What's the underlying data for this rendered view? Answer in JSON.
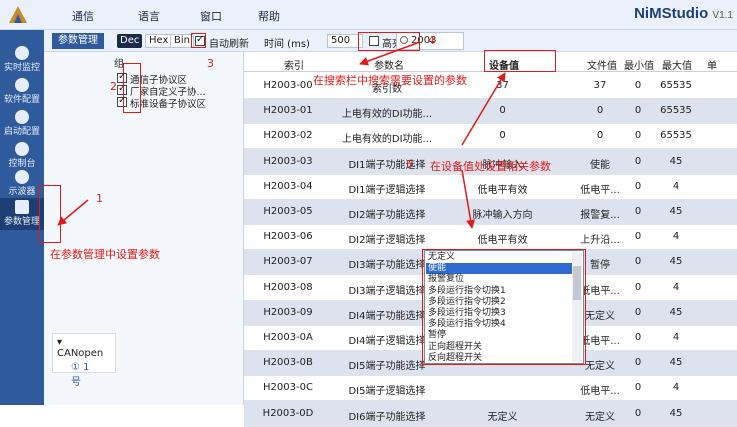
{
  "menubar": {
    "items": [
      "通信",
      "语言",
      "窗口",
      "帮助"
    ],
    "app_title": "NiMStudio",
    "app_version": "V1.1"
  },
  "left_rail": {
    "items": [
      "实时监控",
      "软件配置",
      "启动配置",
      "控制台",
      "示波器",
      "参数管理"
    ],
    "active": "参数管理"
  },
  "toolbar": {
    "param_tab": "参数管理",
    "dec": "Dec",
    "hex": "Hex",
    "bin": "Bin",
    "auto_refresh": "自动刷新",
    "time_label": "时间 (ms)",
    "time_value": "500",
    "highlight": "高亮",
    "search_value": "2003"
  },
  "group_panel": {
    "header": "组",
    "items": [
      "通信子协议区",
      "厂家自定义子协...",
      "标准设备子协议区"
    ],
    "tree_root": "CANopen",
    "tree_child": "1号"
  },
  "table": {
    "columns": [
      "索引",
      "参数名",
      "设备值",
      "文件值",
      "最小值",
      "最大值",
      "单"
    ],
    "rows": [
      [
        "H2003-00",
        "索引数",
        "37",
        "37",
        "0",
        "65535"
      ],
      [
        "H2003-01",
        "上电有效的DI功能...",
        "0",
        "0",
        "0",
        "65535"
      ],
      [
        "H2003-02",
        "上电有效的DI功能...",
        "0",
        "0",
        "0",
        "65535"
      ],
      [
        "H2003-03",
        "DI1端子功能选择",
        "脉冲输入",
        "使能",
        "0",
        "45"
      ],
      [
        "H2003-04",
        "DI1端子逻辑选择",
        "低电平有效",
        "低电平...",
        "0",
        "4"
      ],
      [
        "H2003-05",
        "DI2端子功能选择",
        "脉冲输入方向",
        "报警复...",
        "0",
        "45"
      ],
      [
        "H2003-06",
        "DI2端子逻辑选择",
        "低电平有效",
        "上升沿...",
        "0",
        "4"
      ],
      [
        "H2003-07",
        "DI3端子功能选择",
        "使能",
        "暂停",
        "0",
        "45"
      ],
      [
        "H2003-08",
        "DI3端子逻辑选择",
        "",
        "低电平...",
        "0",
        "4"
      ],
      [
        "H2003-09",
        "DI4端子功能选择",
        "",
        "无定义",
        "0",
        "45"
      ],
      [
        "H2003-0A",
        "DI4端子逻辑选择",
        "",
        "低电平...",
        "0",
        "4"
      ],
      [
        "H2003-0B",
        "DI5端子功能选择",
        "",
        "无定义",
        "0",
        "45"
      ],
      [
        "H2003-0C",
        "DI5端子逻辑选择",
        "",
        "低电平...",
        "0",
        "4"
      ],
      [
        "H2003-0D",
        "DI6端子功能选择",
        "无定义",
        "无定义",
        "0",
        "45"
      ]
    ]
  },
  "dropdown": {
    "selected": "使能",
    "options": [
      "无定义",
      "使能",
      "报警复位",
      "多段运行指令切换1",
      "多段运行指令切换2",
      "多段运行指令切换3",
      "多段运行指令切换4",
      "暂停",
      "正向超程开关",
      "反向超程开关"
    ]
  },
  "annotations": {
    "n1": "1",
    "n2": "2",
    "n3": "3",
    "n4": "4",
    "n5": "5",
    "a1": "在参数管理中设置参数",
    "a4": "在搜索栏中搜索需要设置的参数",
    "a5": "在设备值处设置相关参数"
  },
  "colors": {
    "annotation": "#e21a1a",
    "rail": "#2f5a9c",
    "selected_option": "#2f6ad0",
    "alt_row": "#dde3ee"
  }
}
